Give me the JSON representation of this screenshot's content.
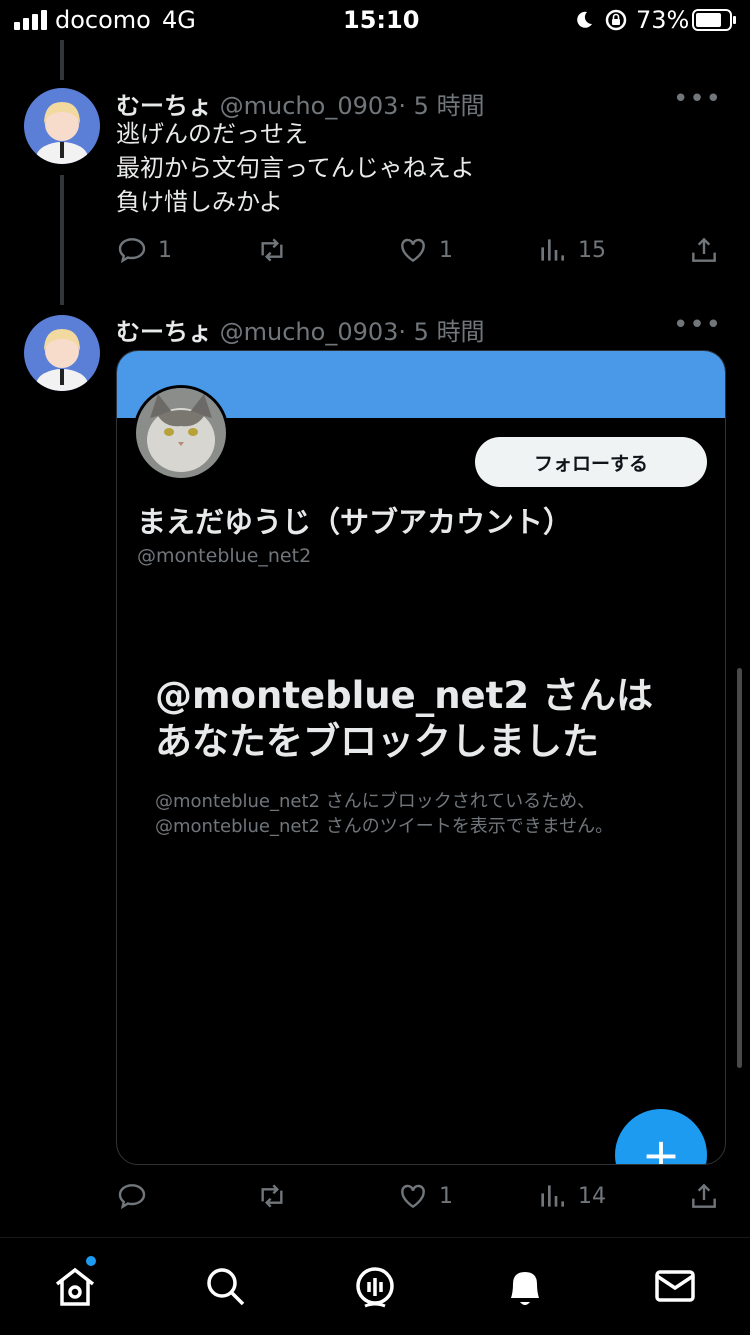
{
  "status_bar": {
    "carrier": "docomo",
    "network": "4G",
    "time": "15:10",
    "battery": "73%"
  },
  "tweets": [
    {
      "name": "むーちょ",
      "handle": "@mucho_0903",
      "time": "· 5 時間",
      "lines": [
        "逃げんのだっせえ",
        "最初から文句言ってんじゃねえよ",
        "負け惜しみかよ"
      ],
      "replies": "1",
      "retweets": "",
      "likes": "1",
      "views": "15"
    },
    {
      "name": "むーちょ",
      "handle": "@mucho_0903",
      "time": "· 5 時間",
      "replies": "",
      "retweets": "",
      "likes": "1",
      "views": "14"
    }
  ],
  "card": {
    "follow_label": "フォローする",
    "display_name": "まえだゆうじ（サブアカウント）",
    "handle": "@monteblue_net2",
    "blocked_title_line1": "@monteblue_net2 さんは",
    "blocked_title_line2": "あなたをブロックしました",
    "blocked_desc_line1": "@monteblue_net2 さんにブロックされているため、",
    "blocked_desc_line2": "@monteblue_net2 さんのツイートを表示できません。",
    "banner_color": "#4a99e9"
  },
  "fab_label": "+",
  "colors": {
    "accent": "#1d9bf0",
    "muted": "#71767b",
    "text": "#e7e9ea",
    "background": "#000000"
  },
  "tabs": [
    "home-icon",
    "search-icon",
    "spaces-icon",
    "bell-icon",
    "mail-icon"
  ]
}
